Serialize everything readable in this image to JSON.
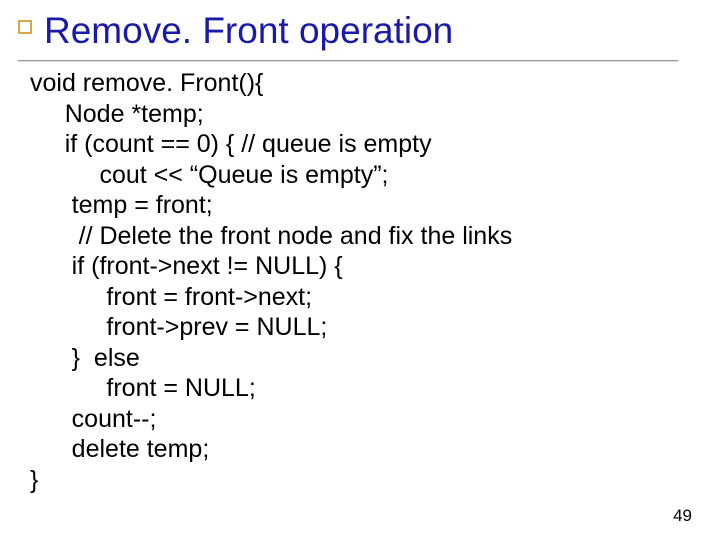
{
  "slide": {
    "title": "Remove. Front operation",
    "page_number": "49",
    "code_lines": {
      "l0": "void remove. Front(){",
      "l1": "     Node *temp;",
      "l2": "     if (count == 0) { // queue is empty",
      "l3": "          cout << “Queue is empty”;",
      "l4": "      temp = front;",
      "l5": "       // Delete the front node and fix the links",
      "l6": "      if (front->next != NULL) {",
      "l7": "           front = front->next;",
      "l8": "           front->prev = NULL;",
      "l9": "      }  else",
      "l10": "           front = NULL;",
      "l11": "      count--;",
      "l12": "      delete temp;",
      "l13": "}"
    }
  }
}
